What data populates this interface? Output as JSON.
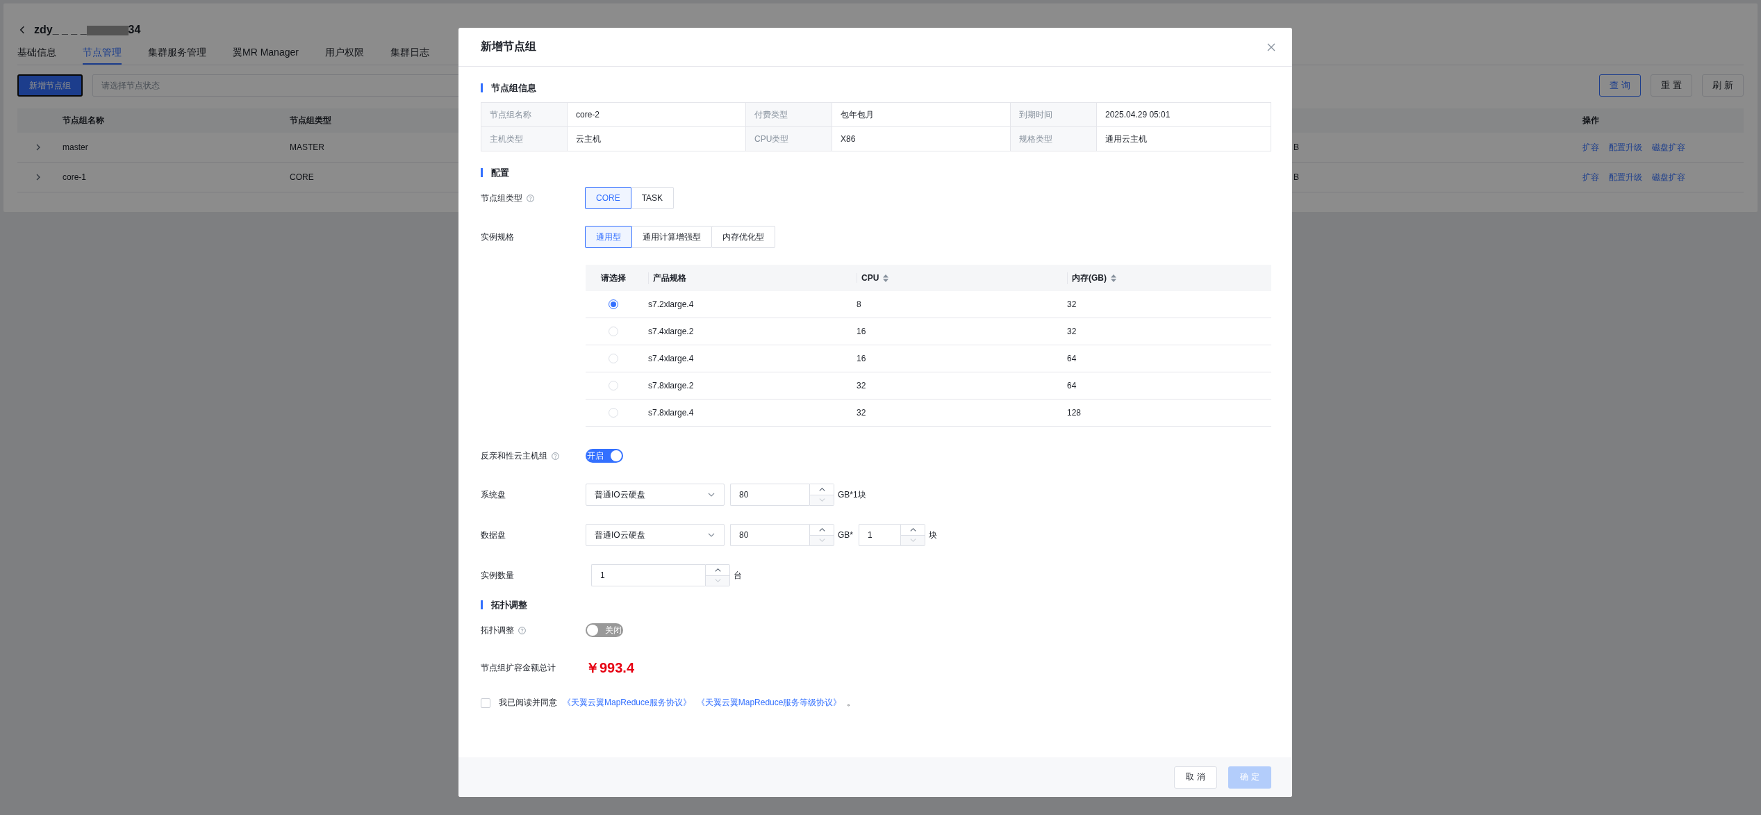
{
  "page": {
    "title_prefix": "zdy_ _ _ _",
    "title_suffix": "34",
    "tabs": [
      {
        "label": "基础信息",
        "selected": false
      },
      {
        "label": "节点管理",
        "selected": true
      },
      {
        "label": "集群服务管理",
        "selected": false
      },
      {
        "label": "翼MR Manager",
        "selected": false
      },
      {
        "label": "用户权限",
        "selected": false
      },
      {
        "label": "集群日志",
        "selected": false
      }
    ],
    "add_button": "新增节点组",
    "status_filter": {
      "placeholder": "请选择节点状态"
    },
    "buttons": [
      {
        "label": "查 询",
        "kind": "primary"
      },
      {
        "label": "重 置",
        "kind": "default"
      },
      {
        "label": "刷 新",
        "kind": "default"
      }
    ],
    "table": {
      "headers": {
        "name": "节点组名称",
        "type": "节点组类型",
        "actions": "操作"
      },
      "rows": [
        {
          "name": "master",
          "type": "MASTER",
          "column_4": "B",
          "actions": [
            "扩容",
            "配置升级",
            "磁盘扩容"
          ]
        },
        {
          "name": "core-1",
          "type": "CORE",
          "column_4": "B",
          "actions": [
            "扩容",
            "配置升级",
            "磁盘扩容"
          ]
        }
      ]
    }
  },
  "modal": {
    "title": "新增节点组",
    "info_section": {
      "title": "节点组信息",
      "rows": [
        [
          {
            "label": "节点组名称",
            "value": "core-2"
          },
          {
            "label": "付费类型",
            "value": "包年包月"
          },
          {
            "label": "到期时间",
            "value": "2025.04.29 05:01"
          }
        ],
        [
          {
            "label": "主机类型",
            "value": "云主机"
          },
          {
            "label": "CPU类型",
            "value": "X86"
          },
          {
            "label": "规格类型",
            "value": "通用云主机"
          }
        ]
      ]
    },
    "config_section": {
      "title": "配置",
      "node_group_type": {
        "label": "节点组类型",
        "help": true,
        "options": [
          {
            "label": "CORE",
            "selected": true
          },
          {
            "label": "TASK",
            "selected": false
          }
        ]
      },
      "instance_spec": {
        "label": "实例规格",
        "options": [
          {
            "label": "通用型",
            "selected": true
          },
          {
            "label": "通用计算增强型",
            "selected": false
          },
          {
            "label": "内存优化型",
            "selected": false
          }
        ]
      },
      "spec_table": {
        "columns": [
          {
            "label": "请选择"
          },
          {
            "label": "产品规格"
          },
          {
            "label": "CPU",
            "sortable": true
          },
          {
            "label": "内存(GB)",
            "sortable": true
          }
        ],
        "rows": [
          {
            "spec": "s7.2xlarge.4",
            "cpu": "8",
            "memory": "32",
            "selected": true
          },
          {
            "spec": "s7.4xlarge.2",
            "cpu": "16",
            "memory": "32",
            "selected": false
          },
          {
            "spec": "s7.4xlarge.4",
            "cpu": "16",
            "memory": "64",
            "selected": false
          },
          {
            "spec": "s7.8xlarge.2",
            "cpu": "32",
            "memory": "64",
            "selected": false
          },
          {
            "spec": "s7.8xlarge.4",
            "cpu": "32",
            "memory": "128",
            "selected": false
          }
        ]
      },
      "anti_affinity": {
        "label": "反亲和性云主机组",
        "help": true,
        "on": true,
        "text": "开启"
      },
      "system_disk": {
        "label": "系统盘",
        "disk_type": "普通IO云硬盘",
        "size": "80",
        "unit": "GB*1块"
      },
      "data_disk": {
        "label": "数据盘",
        "disk_type": "普通IO云硬盘",
        "size": "80",
        "unit": "GB*",
        "count": "1",
        "count_unit": "块"
      },
      "instance_count": {
        "label": "实例数量",
        "value": "1",
        "unit": "台"
      }
    },
    "topology_section": {
      "title": "拓扑调整",
      "toggle": {
        "label": "拓扑调整",
        "help": true,
        "on": false,
        "text": "关闭"
      }
    },
    "total": {
      "label": "节点组扩容金额总计",
      "amount": "￥993.4"
    },
    "agreement": {
      "checked": false,
      "text": "我已阅读并同意",
      "links": [
        "《天翼云翼MapReduce服务协议》",
        "《天翼云翼MapReduce服务等级协议》"
      ],
      "end": "。"
    },
    "footer": [
      {
        "label": "取 消",
        "kind": "default",
        "disabled": false
      },
      {
        "label": "确 定",
        "kind": "primary",
        "disabled": true
      }
    ]
  }
}
